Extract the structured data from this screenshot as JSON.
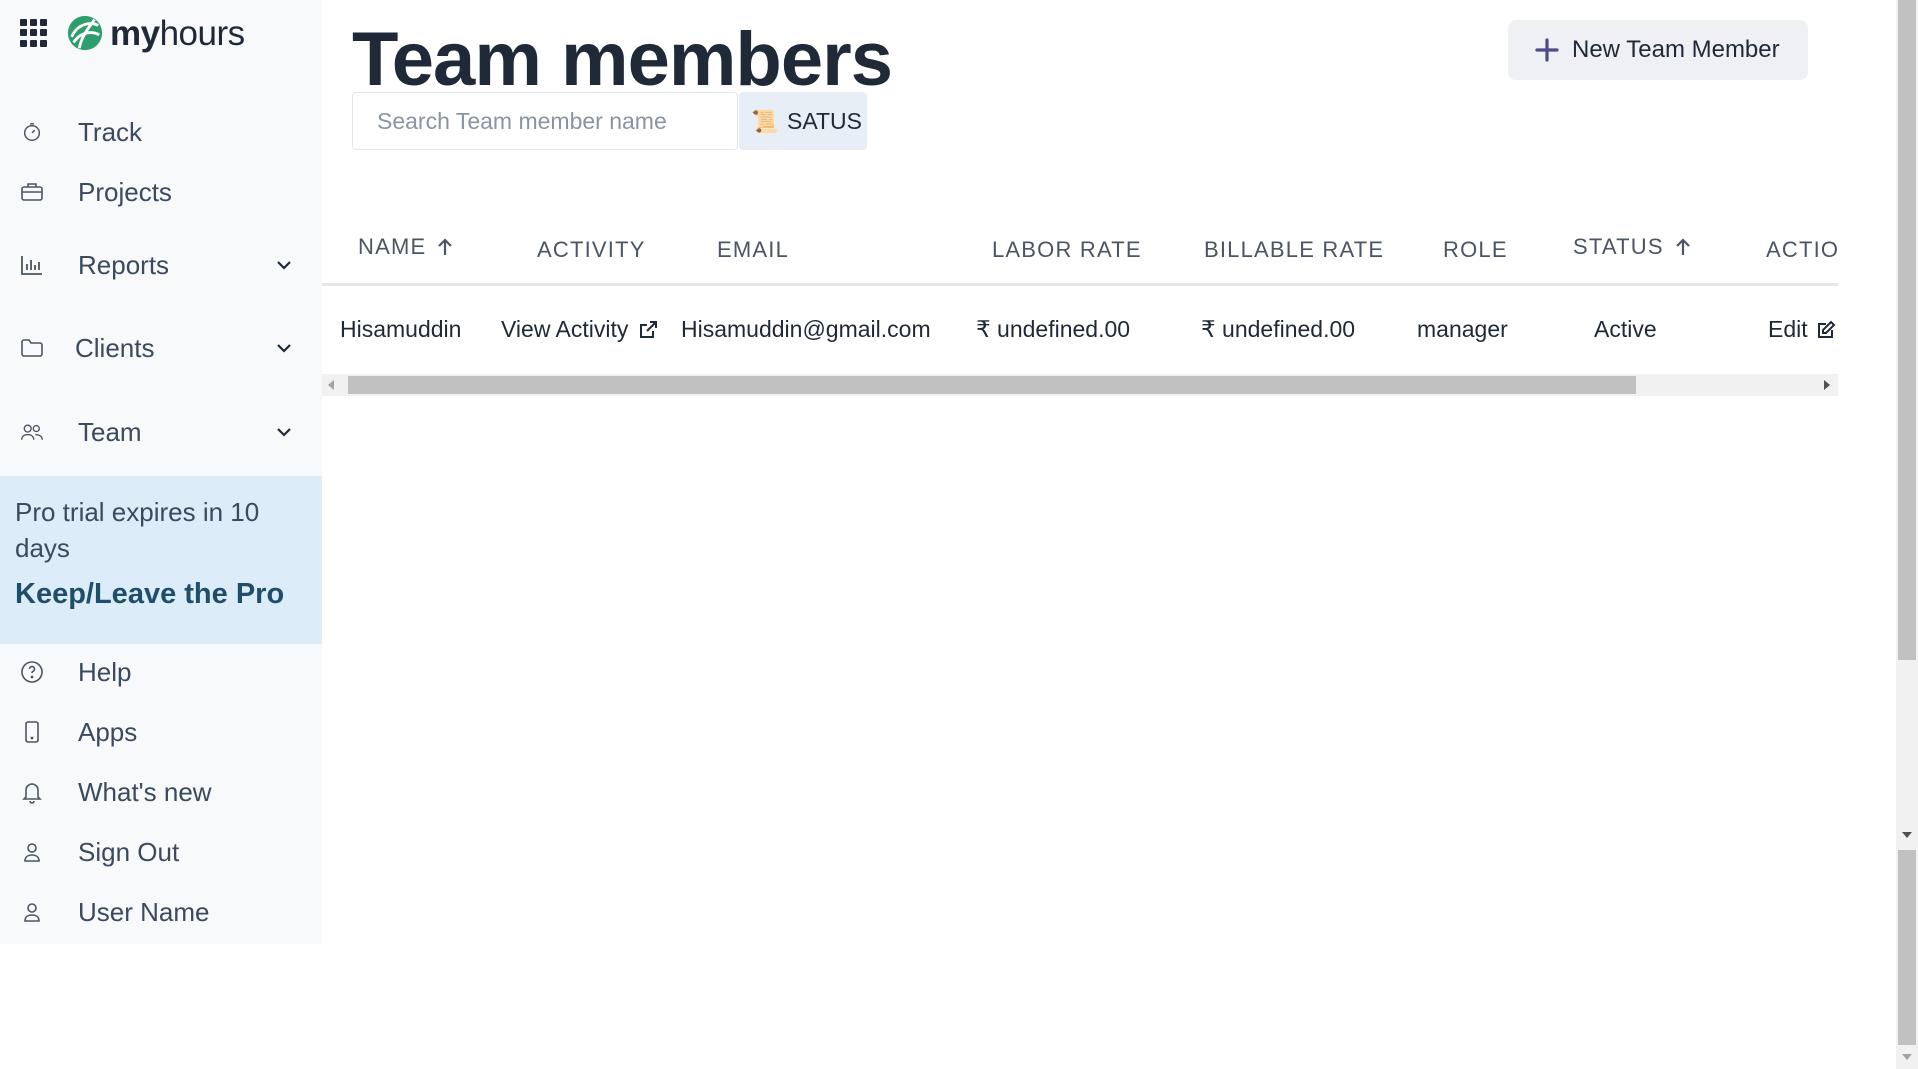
{
  "app": {
    "logo_text_bold": "my",
    "logo_text_light": "hours",
    "brand_color": "#2e9e6e"
  },
  "sidebar": {
    "items": [
      {
        "label": "Track",
        "icon": "timer-icon"
      },
      {
        "label": "Projects",
        "icon": "briefcase-icon"
      },
      {
        "label": "Reports",
        "icon": "bar-chart-icon",
        "expandable": true
      },
      {
        "label": "Clients",
        "icon": "folder-icon",
        "expandable": true
      },
      {
        "label": "Team",
        "icon": "users-icon",
        "expandable": true
      }
    ],
    "promo": {
      "text": "Pro trial expires in 10 days",
      "cta": "Keep/Leave the Pro"
    },
    "bottom_items": [
      {
        "label": "Help",
        "icon": "help-circle-icon"
      },
      {
        "label": "Apps",
        "icon": "smartphone-icon"
      },
      {
        "label": "What's new",
        "icon": "bell-icon"
      },
      {
        "label": "Sign Out",
        "icon": "user-icon"
      },
      {
        "label": "User Name",
        "icon": "user-icon"
      }
    ]
  },
  "main": {
    "title": "Team members",
    "new_button": "New Team Member",
    "search": {
      "placeholder": "Search Team member name",
      "value": ""
    },
    "status_filter": {
      "label": "SATUS",
      "icon": "scroll-icon"
    }
  },
  "table": {
    "columns": [
      "NAME",
      "ACTIVITY",
      "EMAIL",
      "LABOR RATE",
      "BILLABLE RATE",
      "ROLE",
      "STATUS",
      "ACTIO"
    ],
    "sorted_columns": [
      "NAME",
      "STATUS"
    ],
    "rows": [
      {
        "name": "Hisamuddin",
        "activity": "View Activity",
        "email": "Hisamuddin@gmail.com",
        "labor_rate": "₹ undefined.00",
        "billable_rate": "₹ undefined.00",
        "role": "manager",
        "status": "Active",
        "action": "Edit"
      }
    ]
  }
}
